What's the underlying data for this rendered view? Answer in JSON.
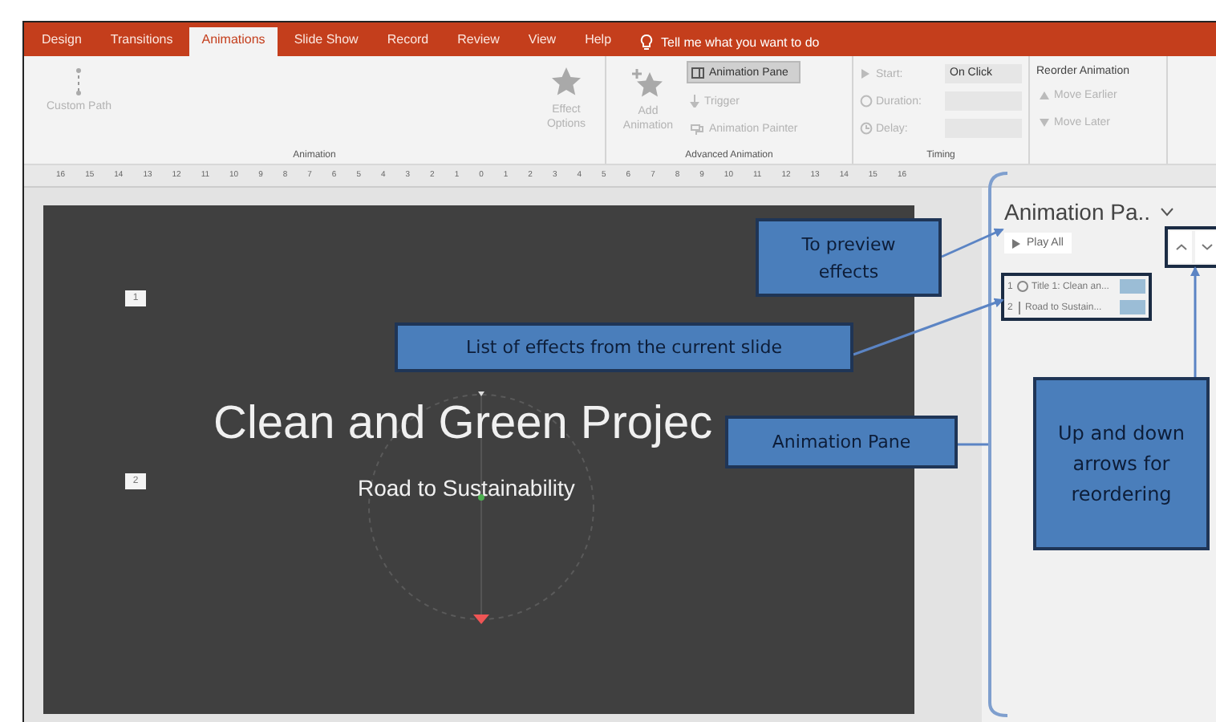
{
  "ribbon": {
    "tabs": [
      {
        "label": "Design",
        "selected": false
      },
      {
        "label": "Transitions",
        "selected": false
      },
      {
        "label": "Animations",
        "selected": true
      },
      {
        "label": "Slide Show",
        "selected": false
      },
      {
        "label": "Record",
        "selected": false
      },
      {
        "label": "Review",
        "selected": false
      },
      {
        "label": "View",
        "selected": false
      },
      {
        "label": "Help",
        "selected": false
      }
    ],
    "tell_me": "Tell me what you want to do",
    "animation_group": {
      "label": "Animation",
      "custom_path": {
        "label": "Custom Path",
        "disabled": true
      },
      "effect_options": {
        "label": "Effect Options",
        "disabled": true
      }
    },
    "advanced_group": {
      "label": "Advanced Animation",
      "add_animation": {
        "label": "Add Animation",
        "disabled": true
      },
      "animation_pane": {
        "label": "Animation Pane",
        "selected": true
      },
      "trigger": {
        "label": "Trigger",
        "disabled": true
      },
      "animation_painter": {
        "label": "Animation Painter",
        "disabled": true
      }
    },
    "timing_group": {
      "label": "Timing",
      "fields": [
        {
          "label": "Start:",
          "value": "On Click",
          "disabled": true
        },
        {
          "label": "Duration:",
          "disabled": true
        },
        {
          "label": "Delay:",
          "disabled": true
        }
      ]
    },
    "reorder_group": {
      "title": "Reorder Animation",
      "commands": [
        {
          "label": "Move Earlier",
          "disabled": true
        },
        {
          "label": "Move Later",
          "disabled": true
        }
      ]
    }
  },
  "ruler": {
    "labels": [
      "16",
      "15",
      "14",
      "13",
      "12",
      "11",
      "10",
      "9",
      "8",
      "7",
      "6",
      "5",
      "4",
      "3",
      "2",
      "1",
      "0",
      "1",
      "2",
      "3",
      "4",
      "5",
      "6",
      "7",
      "8",
      "9",
      "10",
      "11",
      "12",
      "13",
      "14",
      "15",
      "16"
    ]
  },
  "slide": {
    "title": "Clean and Green Projec",
    "subtitle": "Road to Sustainability",
    "tags": [
      "1",
      "2"
    ]
  },
  "animation_pane": {
    "title": "Animation Pa..",
    "play_all": "Play All",
    "effects": [
      {
        "number": "1",
        "kind": "entrance",
        "label": "Title 1: Clean an..."
      },
      {
        "number": "2",
        "kind": "motion",
        "label": "Road to Sustain..."
      }
    ]
  },
  "callouts": [
    {
      "text": "To preview effects"
    },
    {
      "text": "List of effects from the current slide"
    },
    {
      "text": "Animation Pane"
    },
    {
      "text": "Up and down arrows for reordering"
    }
  ]
}
